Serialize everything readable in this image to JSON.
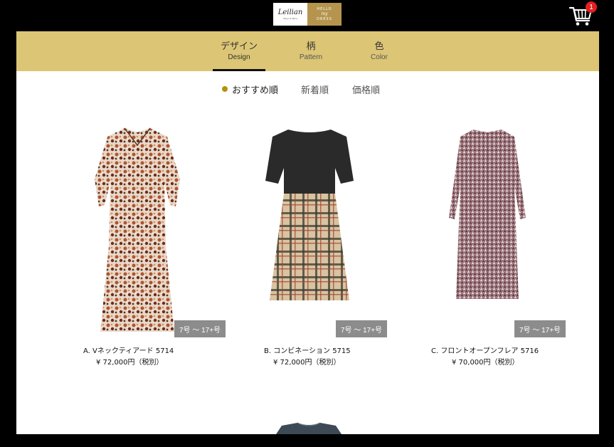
{
  "header": {
    "logo_brand": "Leilian",
    "logo_sub": "Tokyo & Paris",
    "logo_right": [
      "HELLO",
      "my",
      "DRESS"
    ],
    "cart_count": "1"
  },
  "tabs": [
    {
      "jp": "デザイン",
      "en": "Design",
      "active": true
    },
    {
      "jp": "柄",
      "en": "Pattern",
      "active": false
    },
    {
      "jp": "色",
      "en": "Color",
      "active": false
    }
  ],
  "sort": [
    {
      "label": "おすすめ順",
      "active": true
    },
    {
      "label": "新着順",
      "active": false
    },
    {
      "label": "価格順",
      "active": false
    }
  ],
  "products": [
    {
      "name": "A.  Vネックティアード 5714",
      "price": "¥ 72,000円（税別）",
      "sizes": "7号 〜 17+号"
    },
    {
      "name": "B.  コンビネーション 5715",
      "price": "¥ 72,000円（税別）",
      "sizes": "7号 〜 17+号"
    },
    {
      "name": "C.  フロントオープンフレア 5716",
      "price": "¥ 70,000円（税別）",
      "sizes": "7号 〜 17+号"
    }
  ],
  "colors": {
    "tab_bg": "#dcc575",
    "accent_dot": "#b5900c",
    "badge": "#e02020"
  }
}
